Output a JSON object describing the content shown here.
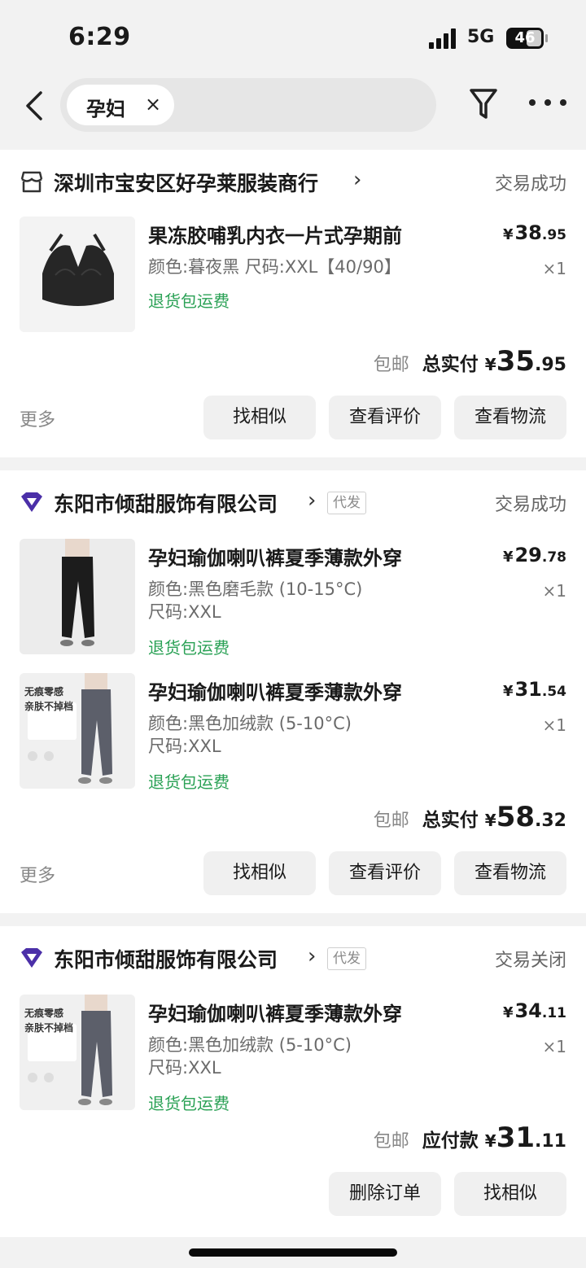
{
  "status_bar": {
    "time": "6:29",
    "network": "5G",
    "battery": "46"
  },
  "search": {
    "chip_label": "孕妇",
    "chip_close": "×"
  },
  "orders": [
    {
      "shop_name": "深圳市宝安区好孕莱服装商行",
      "shop_icon": "store-icon",
      "status": "交易成功",
      "items": [
        {
          "title": "果冻胶哺乳内衣一片式孕期前",
          "spec": "颜色:暮夜黑 尺码:XXL【40/90】",
          "refund": "退货包运费",
          "price_yen": "¥",
          "price_int": "38",
          "price_dec": ".95",
          "qty": "×1"
        }
      ],
      "shipping": "包邮",
      "total_label": "总实付",
      "total_yen": "¥",
      "total_int": "35",
      "total_dec": ".95",
      "more": "更多",
      "buttons": [
        "找相似",
        "查看评价",
        "查看物流"
      ]
    },
    {
      "shop_name": "东阳市倾甜服饰有限公司",
      "shop_icon": "tmall-diamond-icon",
      "badge": "代发",
      "status": "交易成功",
      "items": [
        {
          "title": "孕妇瑜伽喇叭裤夏季薄款外穿",
          "spec": "颜色:黑色磨毛款 (10-15°C)",
          "spec2": "尺码:XXL",
          "refund": "退货包运费",
          "price_yen": "¥",
          "price_int": "29",
          "price_dec": ".78",
          "qty": "×1"
        },
        {
          "title": "孕妇瑜伽喇叭裤夏季薄款外穿",
          "spec": "颜色:黑色加绒款 (5-10°C)",
          "spec2": "尺码:XXL",
          "refund": "退货包运费",
          "price_yen": "¥",
          "price_int": "31",
          "price_dec": ".54",
          "qty": "×1",
          "thumb_text_1": "无痕零感",
          "thumb_text_2": "亲肤不掉档"
        }
      ],
      "shipping": "包邮",
      "total_label": "总实付",
      "total_yen": "¥",
      "total_int": "58",
      "total_dec": ".32",
      "more": "更多",
      "buttons": [
        "找相似",
        "查看评价",
        "查看物流"
      ]
    },
    {
      "shop_name": "东阳市倾甜服饰有限公司",
      "shop_icon": "tmall-diamond-icon",
      "badge": "代发",
      "status": "交易关闭",
      "items": [
        {
          "title": "孕妇瑜伽喇叭裤夏季薄款外穿",
          "spec": "颜色:黑色加绒款 (5-10°C)",
          "spec2": "尺码:XXL",
          "refund": "退货包运费",
          "price_yen": "¥",
          "price_int": "34",
          "price_dec": ".11",
          "qty": "×1",
          "thumb_text_1": "无痕零感",
          "thumb_text_2": "亲肤不掉档"
        }
      ],
      "shipping": "包邮",
      "total_label": "应付款",
      "total_yen": "¥",
      "total_int": "31",
      "total_dec": ".11",
      "buttons": [
        "删除订单",
        "找相似"
      ]
    }
  ],
  "colors": {
    "refund_green": "#2aa155",
    "tmall_purple": "#4b2fa8",
    "page_bg": "#f2f2f2"
  }
}
